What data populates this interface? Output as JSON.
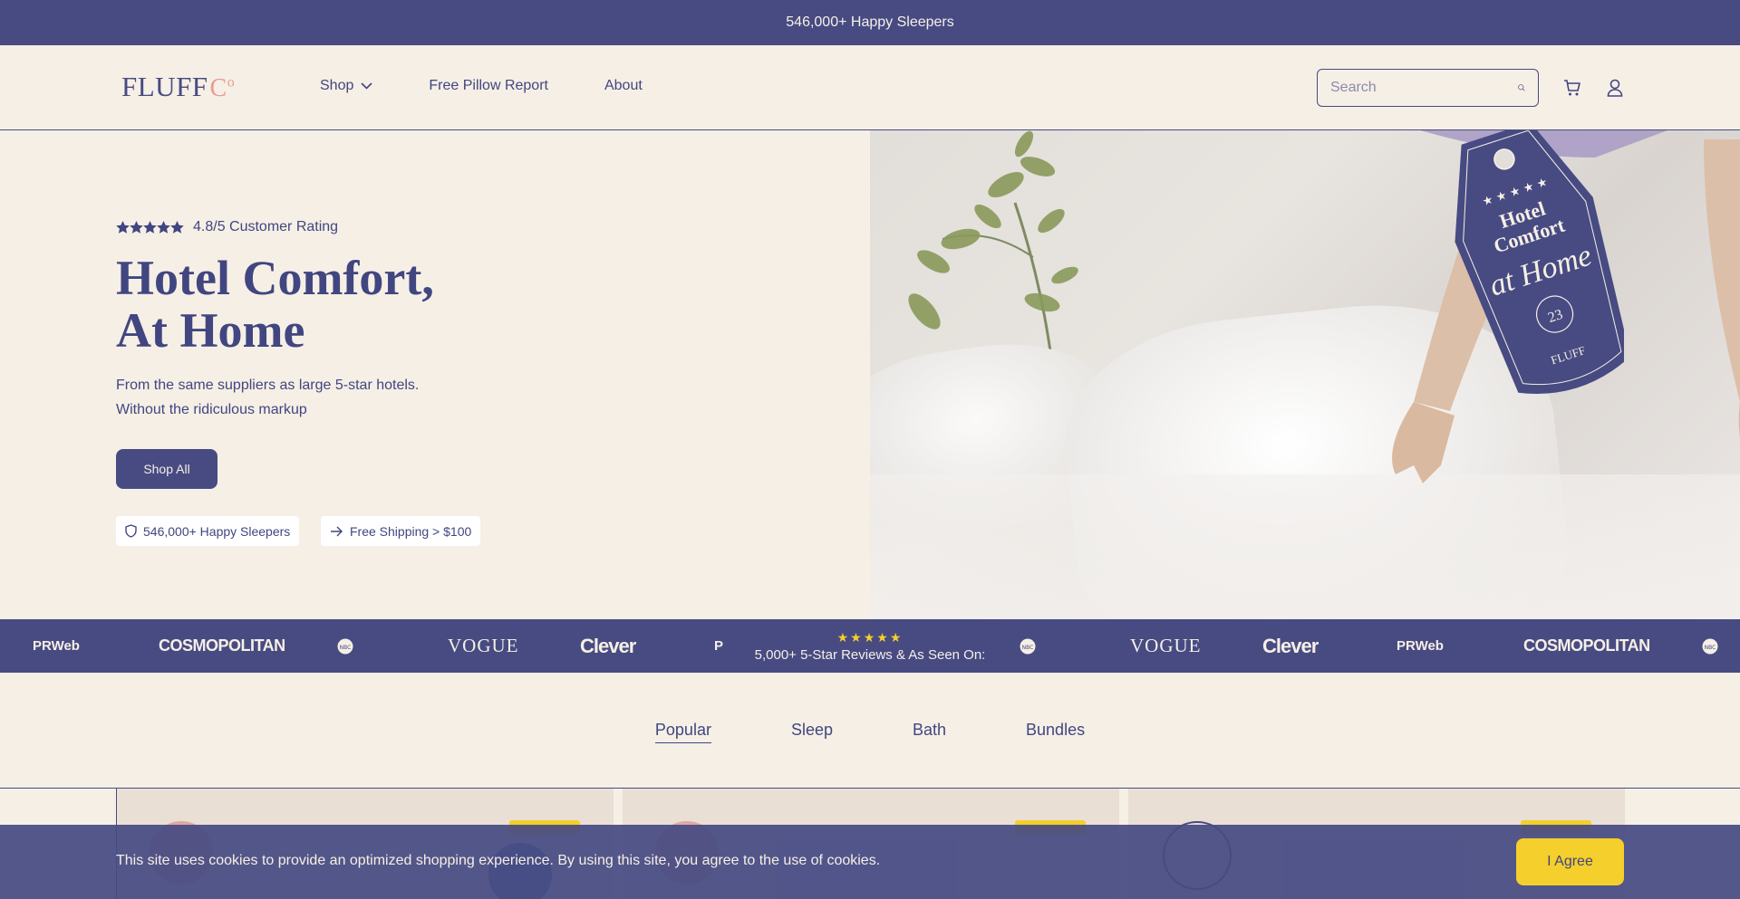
{
  "announcement": {
    "text": "546,000+ Happy Sleepers"
  },
  "header": {
    "logo_main": "FLUFF",
    "logo_co": "C",
    "logo_co_small": "o",
    "nav": [
      {
        "label": "Shop",
        "has_dropdown": true
      },
      {
        "label": "Free Pillow Report"
      },
      {
        "label": "About"
      }
    ],
    "search": {
      "placeholder": "Search",
      "icon": "search-icon"
    },
    "icons": [
      "cart-icon",
      "account-icon"
    ]
  },
  "hero": {
    "rating_text": "4.8/5 Customer Rating",
    "rating_stars": 5,
    "title_line1": "Hotel Comfort,",
    "title_line2": "At Home",
    "subtitle_line1": "From the same suppliers as large 5-star hotels.",
    "subtitle_line2": "Without the ridiculous markup",
    "cta_label": "Shop All",
    "badges": [
      {
        "icon": "shield-icon",
        "text": "546,000+ Happy Sleepers"
      },
      {
        "icon": "arrow-right-icon",
        "text": "Free Shipping > $100"
      }
    ],
    "tag": {
      "line1": "Hotel",
      "line2": "Comfort",
      "script": "at Home",
      "number": "23",
      "brand": "FLUFF"
    }
  },
  "press": {
    "center_stars": "★★★★★",
    "center_caption": "5,000+ 5-Star Reviews & As Seen On:",
    "logos": [
      "PRWeb",
      "COSMOPOLITAN",
      "NBC",
      "VOGUE",
      "Clever",
      "P",
      "NBC",
      "VOGUE",
      "Clever",
      "PRWeb",
      "COSMOPOLITAN",
      "NBC"
    ]
  },
  "tabs": [
    {
      "label": "Popular",
      "active": true
    },
    {
      "label": "Sleep",
      "active": false
    },
    {
      "label": "Bath",
      "active": false
    },
    {
      "label": "Bundles",
      "active": false
    }
  ],
  "cookie": {
    "text": "This site uses cookies to provide an optimized shopping experience. By using this site, you agree to the use of cookies.",
    "button_label": "I Agree"
  },
  "colors": {
    "brand": "#474b82",
    "background": "#f6efe6",
    "accent": "#f5cf2b",
    "logo_co": "#e89a93"
  }
}
